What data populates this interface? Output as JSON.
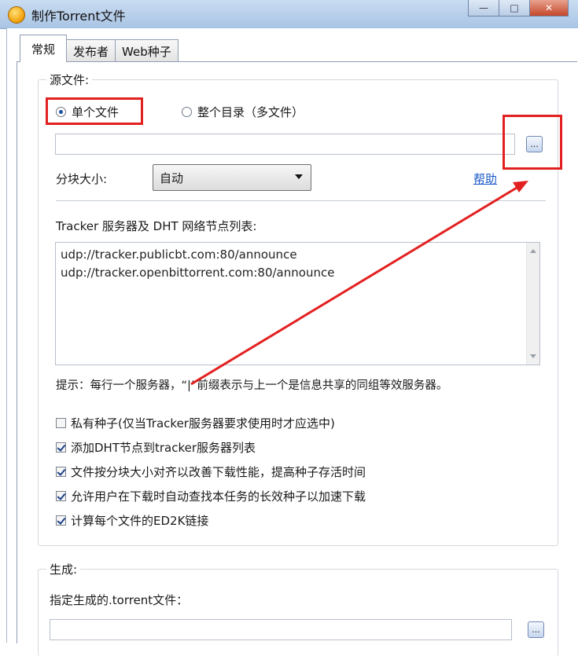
{
  "window": {
    "title": "制作Torrent文件",
    "minimize": "—",
    "maximize": "□",
    "close": "✕"
  },
  "tabs": [
    {
      "label": "常规",
      "active": true
    },
    {
      "label": "发布者",
      "active": false
    },
    {
      "label": "Web种子",
      "active": false
    }
  ],
  "source": {
    "group_label": "源文件:",
    "radio_single": "单个文件",
    "radio_directory": "整个目录（多文件）",
    "selected": "单个文件",
    "path_value": "",
    "browse_label": "...",
    "piece_size_label": "分块大小:",
    "piece_size_value": "自动",
    "help_link": "帮助"
  },
  "tracker": {
    "label": "Tracker 服务器及 DHT 网络节点列表:",
    "lines": [
      "udp://tracker.publicbt.com:80/announce",
      "udp://tracker.openbittorrent.com:80/announce"
    ],
    "hint": "提示：每行一个服务器，“|”前缀表示与上一个是信息共享的同组等效服务器。"
  },
  "options": [
    {
      "label": "私有种子(仅当Tracker服务器要求使用时才应选中)",
      "checked": false
    },
    {
      "label": "添加DHT节点到tracker服务器列表",
      "checked": true
    },
    {
      "label": "文件按分块大小对齐以改善下载性能，提高种子存活时间",
      "checked": true
    },
    {
      "label": "允许用户在下载时自动查找本任务的长效种子以加速下载",
      "checked": true
    },
    {
      "label": "计算每个文件的ED2K链接",
      "checked": true
    }
  ],
  "output": {
    "group_label": "生成:",
    "file_label": "指定生成的.torrent文件：",
    "file_value": "",
    "browse_label": "..."
  },
  "colors": {
    "highlight": "#e32020",
    "link": "#1a59c8"
  }
}
